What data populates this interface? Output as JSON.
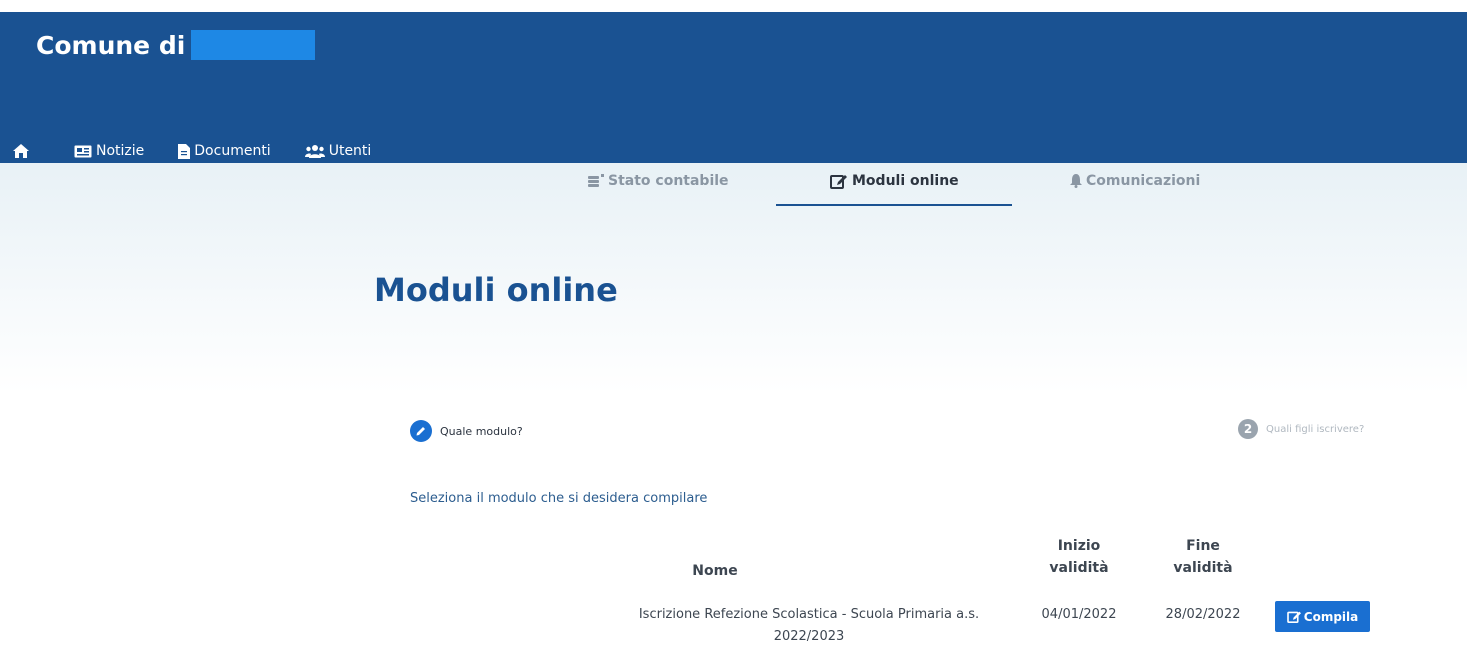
{
  "header": {
    "brand": "Comune di",
    "brand_color": "#1a5292"
  },
  "nav": {
    "items": [
      {
        "icon": "home-icon",
        "label": ""
      },
      {
        "icon": "newspaper-icon",
        "label": "Notizie"
      },
      {
        "icon": "document-icon",
        "label": "Documenti"
      },
      {
        "icon": "users-icon",
        "label": "Utenti"
      }
    ]
  },
  "tabs": [
    {
      "icon": "ledger-icon",
      "label": "Stato contabile",
      "active": false
    },
    {
      "icon": "edit-icon",
      "label": "Moduli online",
      "active": true
    },
    {
      "icon": "bell-icon",
      "label": "Comunicazioni",
      "active": false
    }
  ],
  "page": {
    "title": "Moduli online"
  },
  "steps": {
    "current": {
      "icon": "pencil-icon",
      "label": "Quale modulo?"
    },
    "next": {
      "number": "2",
      "label": "Quali figli iscrivere?"
    }
  },
  "instruction": "Seleziona il modulo che si desidera compilare",
  "table": {
    "headers": {
      "nome": "Nome",
      "inizio_1": "Inizio",
      "inizio_2": "validità",
      "fine_1": "Fine",
      "fine_2": "validità"
    },
    "rows": [
      {
        "nome_1": "Iscrizione Refezione Scolastica - Scuola Primaria a.s.",
        "nome_2": "2022/2023",
        "inizio": "04/01/2022",
        "fine": "28/02/2022",
        "action": "Compila"
      }
    ]
  },
  "colors": {
    "accent": "#1a6fd1",
    "title": "#1a5292"
  }
}
